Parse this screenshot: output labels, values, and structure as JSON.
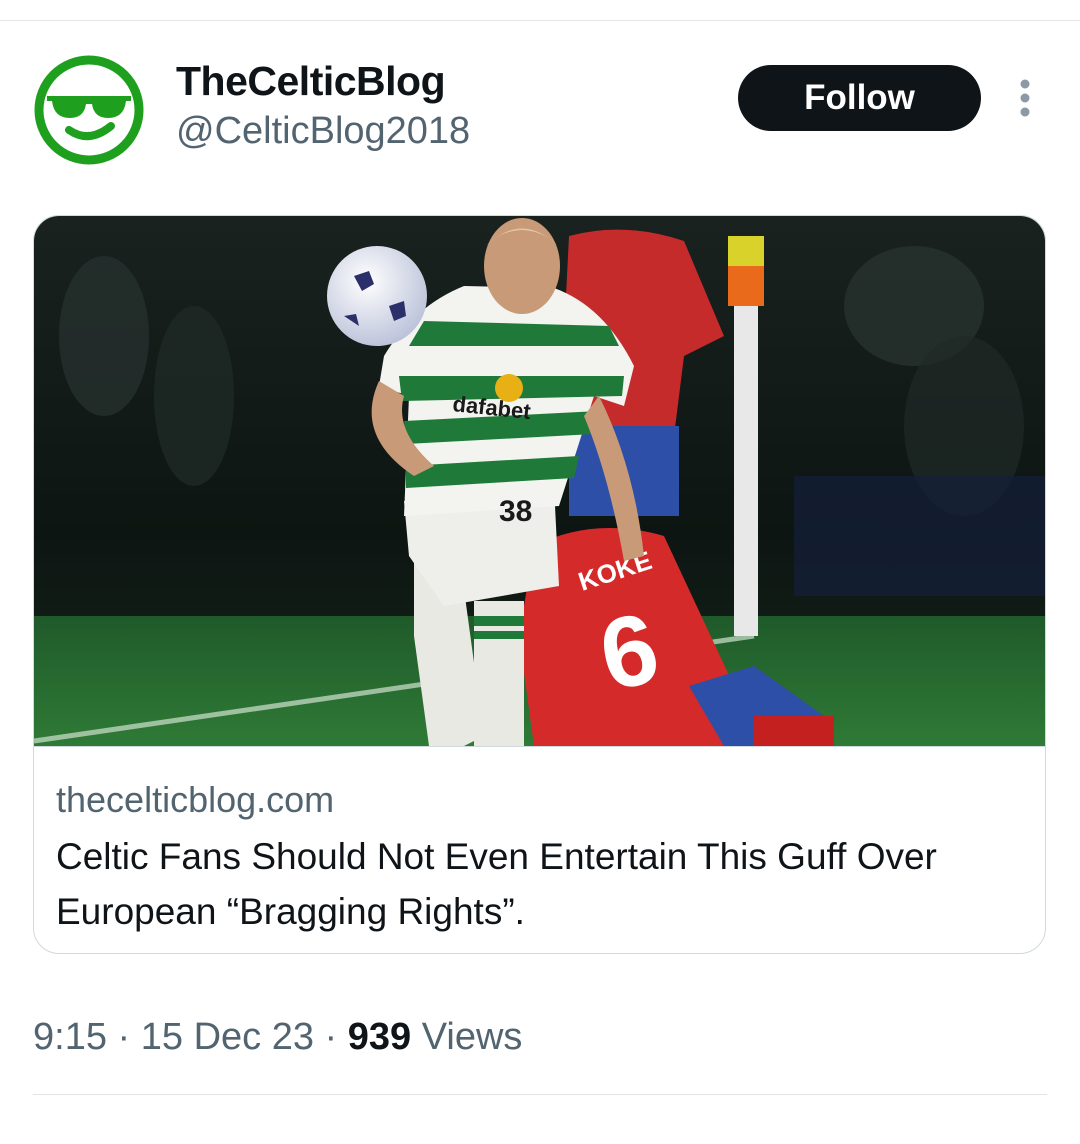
{
  "author": {
    "name": "TheCelticBlog",
    "handle": "@CelticBlog2018",
    "avatar_icon": "sunglasses-smiley-icon",
    "avatar_color": "#1ea01e"
  },
  "actions": {
    "follow_label": "Follow",
    "more_icon": "vertical-ellipsis-icon"
  },
  "link_card": {
    "domain": "thecelticblog.com",
    "title": "Celtic Fans Should Not Even Entertain This Guff Over European “Bragging Rights”.",
    "image_texts": {
      "shirt_sponsor": "dafabet",
      "shirt_number": "38",
      "opponent_name": "KOKE",
      "opponent_number": "6"
    }
  },
  "meta": {
    "time": "9:15",
    "separator_1": " · ",
    "date": "15 Dec 23",
    "separator_2": " · ",
    "views_count": "939",
    "views_label": " Views"
  },
  "colors": {
    "text_primary": "#0f1419",
    "text_secondary": "#536471",
    "border": "#cfd9de",
    "follow_bg": "#0f1419"
  }
}
